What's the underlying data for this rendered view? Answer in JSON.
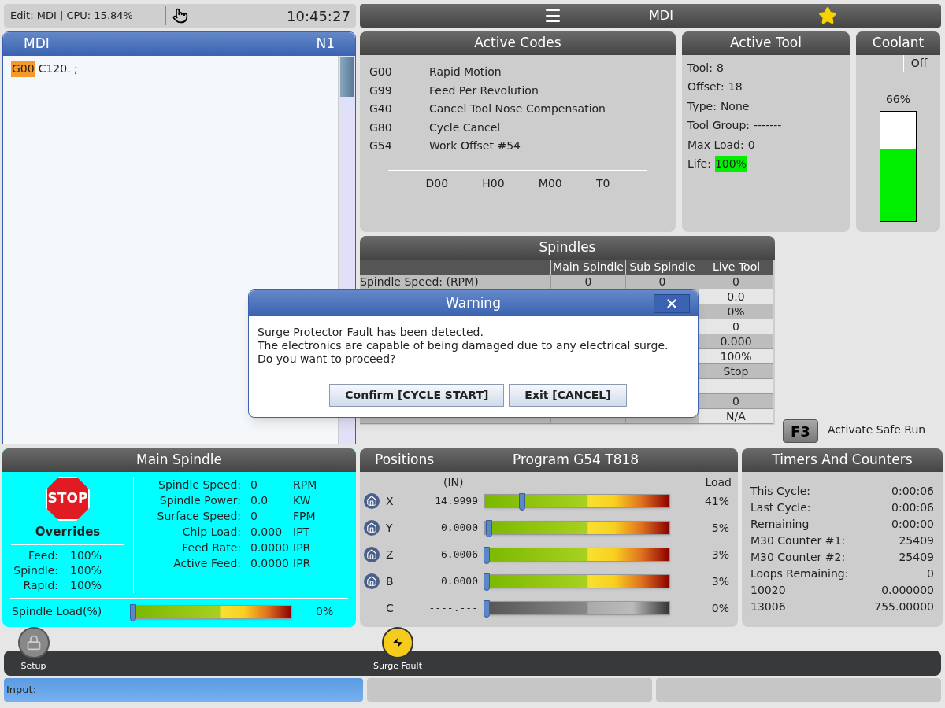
{
  "status_bar": {
    "text": "Edit: MDI | CPU: 15.84%",
    "time": "10:45:27"
  },
  "mode_header": {
    "title": "MDI",
    "favorite": true
  },
  "mdi": {
    "title": "MDI",
    "line": "N1",
    "tokens": [
      {
        "text": "G00",
        "highlighted": true
      },
      {
        "text": "C120. ;",
        "highlighted": false
      }
    ]
  },
  "active_codes": {
    "title": "Active Codes",
    "codes": [
      {
        "code": "G00",
        "description": "Rapid Motion"
      },
      {
        "code": "G99",
        "description": "Feed Per Revolution"
      },
      {
        "code": "G40",
        "description": "Cancel Tool Nose Compensation"
      },
      {
        "code": "G80",
        "description": "Cycle Cancel"
      },
      {
        "code": "G54",
        "description": "Work Offset #54"
      }
    ],
    "modal": [
      "D00",
      "H00",
      "M00",
      "T0"
    ]
  },
  "active_tool": {
    "title": "Active Tool",
    "fields": [
      {
        "label": "Tool:",
        "value": "8",
        "highlighted": false
      },
      {
        "label": "Offset:",
        "value": "18",
        "highlighted": false
      },
      {
        "label": "Type:",
        "value": "None",
        "highlighted": false
      },
      {
        "label": "Tool Group:",
        "value": "-------",
        "highlighted": false
      },
      {
        "label": "Max Load:",
        "value": "0",
        "highlighted": false
      },
      {
        "label": "Life:",
        "value": "100%",
        "highlighted": true
      }
    ]
  },
  "coolant": {
    "title": "Coolant",
    "status": "Off",
    "reading": "66%",
    "level": 0.66
  },
  "spindles": {
    "title": "Spindles",
    "columns": [
      "Main Spindle",
      "Sub Spindle",
      "Live Tool"
    ],
    "rows": [
      {
        "label": "Spindle Speed: (RPM)",
        "main": "0",
        "sub": "0",
        "live": "0"
      },
      {
        "live": "0.0"
      },
      {
        "live": "0%"
      },
      {
        "live": "0"
      },
      {
        "live": "0.000"
      },
      {
        "live": "100%"
      },
      {
        "live": "Stop"
      },
      {},
      {
        "live": "0"
      },
      {
        "live": "N/A"
      }
    ]
  },
  "safe_run": {
    "key": "F3",
    "label": "Activate Safe Run"
  },
  "warning_dialog": {
    "title": "Warning",
    "lines": [
      "Surge Protector Fault has been detected.",
      "The electronics are capable of being damaged due to any electrical surge.",
      "Do you want to proceed?"
    ],
    "buttons": [
      "Confirm [CYCLE START]",
      "Exit [CANCEL]"
    ]
  },
  "main_spindle": {
    "title": "Main Spindle",
    "stop_sign": "STOP",
    "overrides_title": "Overrides",
    "overrides": [
      {
        "label": "Feed:",
        "value": "100%"
      },
      {
        "label": "Spindle:",
        "value": "100%"
      },
      {
        "label": "Rapid:",
        "value": "100%"
      }
    ],
    "readings": [
      {
        "label": "Spindle Speed:",
        "value": "0",
        "unit": "RPM"
      },
      {
        "label": "Spindle Power:",
        "value": "0.0",
        "unit": "KW"
      },
      {
        "label": "Surface Speed:",
        "value": "0",
        "unit": "FPM"
      },
      {
        "label": "Chip Load:",
        "value": "0.000",
        "unit": "IPT"
      },
      {
        "label": "Feed Rate:",
        "value": "0.0000",
        "unit": "IPR"
      },
      {
        "label": "Active Feed:",
        "value": "0.0000",
        "unit": "IPR"
      }
    ],
    "load": {
      "label": "Spindle Load(%)",
      "level": 0,
      "reading": "0%"
    }
  },
  "positions": {
    "title": "Positions",
    "program": "Program G54 T818",
    "unit": "(IN)",
    "load_heading": "Load",
    "axes": [
      {
        "axis": "X",
        "value": "14.9999",
        "level": 0.2,
        "load": "41%",
        "active": true
      },
      {
        "axis": "Y",
        "value": "0.0000",
        "level": 0.02,
        "load": "5%",
        "active": true
      },
      {
        "axis": "Z",
        "value": "6.0006",
        "level": 0.01,
        "load": "3%",
        "active": true
      },
      {
        "axis": "B",
        "value": "0.0000",
        "level": 0.01,
        "load": "3%",
        "active": true
      },
      {
        "axis": "C",
        "value": "----.---",
        "level": 0.01,
        "load": "0%",
        "active": false
      }
    ]
  },
  "timers": {
    "title": "Timers And Counters",
    "items": [
      {
        "label": "This Cycle:",
        "value": "0:00:06"
      },
      {
        "label": "Last Cycle:",
        "value": "0:00:06"
      },
      {
        "label": "Remaining",
        "value": "0:00:00"
      },
      {
        "label": "M30 Counter #1:",
        "value": "25409"
      },
      {
        "label": "M30 Counter #2:",
        "value": "25409"
      },
      {
        "label": "Loops Remaining:",
        "value": "0"
      },
      {
        "label": "10020",
        "value": "0.000000"
      },
      {
        "label": "13006",
        "value": "755.00000"
      }
    ]
  },
  "bottom_bar": {
    "buttons": [
      {
        "label": "Setup",
        "kind": "lock"
      },
      {
        "label": "Surge Fault",
        "kind": "warning"
      }
    ]
  },
  "input": {
    "label": "Input:"
  }
}
